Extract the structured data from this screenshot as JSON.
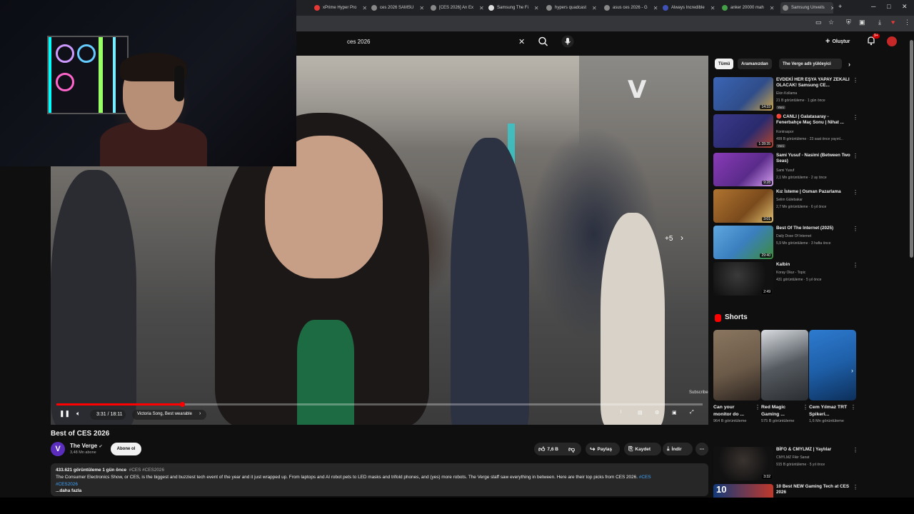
{
  "browser": {
    "tabs": [
      {
        "label": "xPrime Hyper Pro",
        "fav": "#e53935"
      },
      {
        "label": "ces 2026 SAMSU",
        "fav": "#888888"
      },
      {
        "label": "[CES 2026] An Ex",
        "fav": "#888888"
      },
      {
        "label": "Samsung The Fi",
        "fav": "#dddddd"
      },
      {
        "label": "hypers quadcast",
        "fav": "#888888"
      },
      {
        "label": "asus ces 2026 - G",
        "fav": "#888888"
      },
      {
        "label": "Always Incredible",
        "fav": "#3f51b5"
      },
      {
        "label": "anker 20000 mah",
        "fav": "#43a047"
      },
      {
        "label": "Samsung Unveils",
        "fav": "#888888"
      }
    ],
    "new_tab": "+",
    "window_controls": {
      "minimize": "─",
      "maximize": "□",
      "close": "✕"
    }
  },
  "header": {
    "search_value": "ces 2026",
    "clear_icon": "✕",
    "create_label": "Oluştur",
    "notif_badge": "9+"
  },
  "player": {
    "watermark": "V",
    "more_label": "+5",
    "subscribe_watermark": "Subscribe",
    "time": "3:31 / 18:11",
    "chapter": "Victoria Song, Best wearable",
    "progress": 0.194
  },
  "video": {
    "title": "Best of CES 2026",
    "channel": "The Verge",
    "channel_verified": "✔",
    "subscribers": "3,48 Mn abone",
    "subscribe_label": "Abone ol",
    "likes": "7,6 B",
    "share_label": "Paylaş",
    "save_label": "Kaydet",
    "download_label": "İndir",
    "views_line": "433.621 görüntüleme  1 gün önce",
    "hashtags": "#CES #CES2026",
    "description": "The Consumer Electronics Show, or CES, is the biggest and buzziest tech event of the year and it just wrapped up. From laptops and AI robot pets to LED masks and trifold phones, and (yes) more robots. The Verge staff saw everything in between. Here are their top picks from CES 2026.",
    "desc_tag1": "#CES",
    "desc_tag2": "#CES2026",
    "more_label": "...daha fazla"
  },
  "sidebar": {
    "chips": [
      "Tümü",
      "Aramanızdan",
      "The Verge adlı yükleyici"
    ],
    "recs": [
      {
        "title": "EVDEKİ HER EŞYA YAPAY ZEKALI OLACAK! Samsung CE...",
        "channel": "Ekin Kollama",
        "meta": "21 B görüntüleme · 1 gün önce",
        "badge": "Yeni",
        "duration": "14:33",
        "thumb": "#2f4d8a"
      },
      {
        "title": "🔴 CANLI | Galatasaray - Fenerbahçe Maç Sonu | Nihat ...",
        "channel": "Kontraspor",
        "meta": "499 B görüntüleme · 23 saat önce yayınl...",
        "badge": "Yeni",
        "duration": "1:28:35",
        "thumb": "#2a2a6e"
      },
      {
        "title": "Sami Yusuf - Nasimi (Between Two Seas)",
        "channel": "Sami Yusuf",
        "meta": "2,1 Mn görüntüleme · 2 ay önce",
        "badge": "",
        "duration": "9:28",
        "thumb": "#5a2b8a"
      },
      {
        "title": "Kız İsteme | Osman Pazarlama",
        "channel": "Selim Gülebakar",
        "meta": "2,7 Mn görüntüleme · 6 yıl önce",
        "badge": "",
        "duration": "3:01",
        "thumb": "#7a4a1c"
      },
      {
        "title": "Best Of The Internet (2025)",
        "channel": "Daily Dose Of Internet",
        "meta": "5,9 Mn görüntüleme · 3 hafta önce",
        "badge": "",
        "duration": "29:40",
        "thumb": "#3b7fbf"
      },
      {
        "title": "Kalbin",
        "channel": "Koray Okur - Topic",
        "meta": "431 görüntüleme · 5 yıl önce",
        "badge": "",
        "duration": "2:49",
        "thumb": "#1d1d1d"
      }
    ],
    "shorts_title": "Shorts",
    "shorts": [
      {
        "title": "Can your monitor do ...",
        "views": "964 B görüntüleme",
        "thumb": "#6b5a48"
      },
      {
        "title": "Red Magic Gaming ...",
        "views": "575 B görüntüleme",
        "thumb": "#555a60"
      },
      {
        "title": "Cem Yılmaz TRT Spikeri...",
        "views": "1,6 Mn görüntüleme",
        "thumb": "#1e5fa8"
      }
    ],
    "recs2": [
      {
        "title": "BİFO & CMYLMZ | Yaylılar",
        "channel": "CMYLMZ Fikir Sanat",
        "meta": "915 B görüntüleme · 5 yıl önce",
        "duration": "3:32",
        "thumb": "#1a1a1a"
      },
      {
        "title": "10 Best NEW Gaming Tech at CES 2026",
        "channel": "",
        "meta": "",
        "duration": "",
        "thumb": "#123a7a",
        "thumb_text": "10"
      }
    ]
  }
}
